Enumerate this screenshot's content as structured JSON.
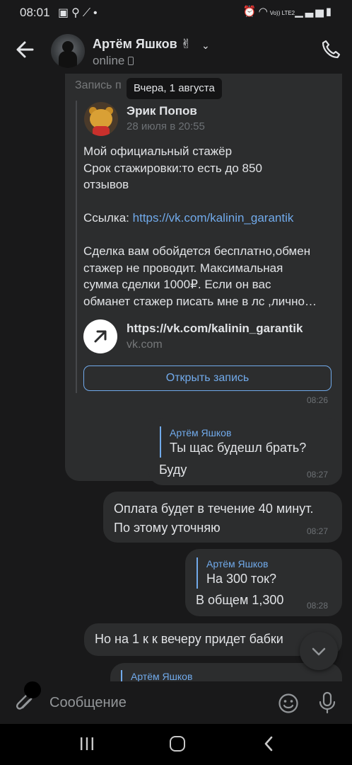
{
  "status_bar": {
    "time": "08:01",
    "left_icons": [
      "gallery-icon",
      "search-icon",
      "magic-icon",
      "dot-icon"
    ],
    "right_icons": [
      "alarm-icon",
      "wifi-icon",
      "lte-icon",
      "signal-icon",
      "battery-icon"
    ],
    "network_label": "Vo)) LTE2"
  },
  "header": {
    "contact_name": "Артём Яшков ✌",
    "status": "online"
  },
  "date_tooltip": "Вчера, 1 августа",
  "forwarded_post": {
    "label": "Запись п",
    "author": "Эрик Попов",
    "date": "28 июля в 20:55",
    "text_part1": "Мой официальный стажёр\nСрок стажировки:то есть до 850\nотзывов",
    "link_prefix": "Ссылка: ",
    "link_url": "https://vk.com/kalinin_garantik",
    "text_part2": "Сделка вам обойдется бесплатно,обмен\nстажер не  проводит. Максимальная\nсумма сделки 1000₽. Если он вас\nобманет стажер писать мне в лс ,лично…",
    "attachment_title": "https://vk.com/kalinin_garantik",
    "attachment_domain": "vk.com",
    "open_button": "Открыть запись",
    "time": "08:26"
  },
  "messages": [
    {
      "reply_to": "Артём Яшков",
      "reply_text": "Ты щас будешл брать?",
      "text": "Буду",
      "time": "08:27"
    },
    {
      "text": "Оплата будет в течение  40 минут.\nПо этому уточняю",
      "time": "08:27"
    },
    {
      "reply_to": "Артём Яшков",
      "reply_text": "На 300 ток?",
      "text": "В общем 1,300",
      "time": "08:28"
    },
    {
      "text": "Но на 1 к к вечеру придет бабки"
    },
    {
      "reply_to": "Артём Яшков"
    }
  ],
  "composer": {
    "placeholder": "Сообщение"
  },
  "colors": {
    "background": "#19191a",
    "bubble": "#2c2d2e",
    "accent": "#71aaeb",
    "text": "#e1e3e6",
    "secondary_text": "#939699"
  }
}
